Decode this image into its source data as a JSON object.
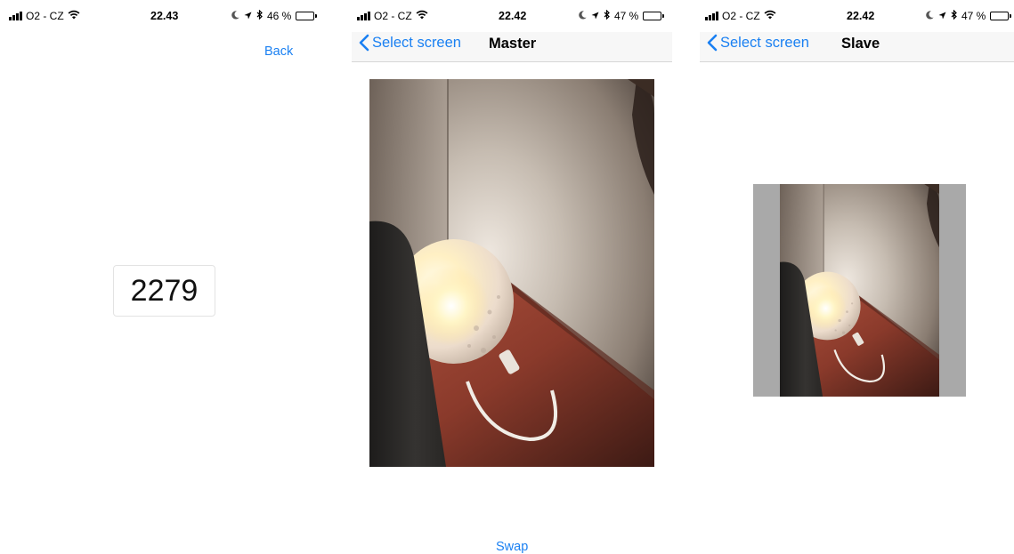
{
  "screen1": {
    "status": {
      "carrier": "O2 - CZ",
      "time": "22.43",
      "battery_text": "46 %",
      "battery_level": 0.46
    },
    "back_label": "Back",
    "code": "2279"
  },
  "screen2": {
    "status": {
      "carrier": "O2 - CZ",
      "time": "22.42",
      "battery_text": "47 %",
      "battery_level": 0.47
    },
    "nav": {
      "back_label": "Select screen",
      "title": "Master"
    },
    "swap_label": "Swap"
  },
  "screen3": {
    "status": {
      "carrier": "O2 - CZ",
      "time": "22.42",
      "battery_text": "47 %",
      "battery_level": 0.47
    },
    "nav": {
      "back_label": "Select screen",
      "title": "Slave"
    }
  },
  "colors": {
    "accent": "#1a80f2",
    "nav_background": "#f7f7f7",
    "letterbox": "#a9a9a9"
  },
  "icons": [
    "signal-icon",
    "wifi-icon",
    "moon-icon",
    "location-icon",
    "bluetooth-icon",
    "battery-icon",
    "chevron-left-icon"
  ]
}
